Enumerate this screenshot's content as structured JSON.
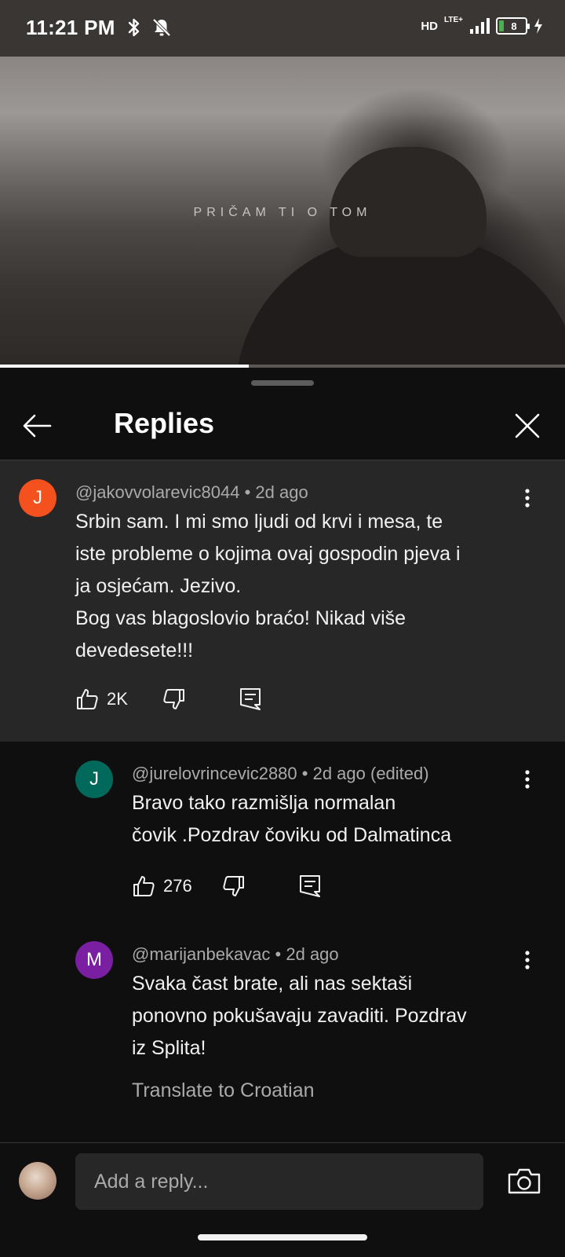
{
  "status_bar": {
    "time": "11:21 PM",
    "network": "HD",
    "network_type": "LTE+",
    "battery_level": "8",
    "icons": [
      "bluetooth-icon",
      "mute-icon",
      "signal-icon",
      "battery-icon",
      "charging-icon"
    ]
  },
  "video": {
    "caption": "PRIČAM TI O TOM",
    "progress": 0.44
  },
  "panel": {
    "title": "Replies",
    "back_icon": "back-arrow-icon",
    "close_icon": "close-icon"
  },
  "comments": [
    {
      "avatar_letter": "J",
      "avatar_color": "#f4511e",
      "author": "@jakovvolarevic8044",
      "time": "2d ago",
      "lines": [
        "Srbin sam. I mi smo ljudi od krvi i mesa, te",
        "iste probleme o kojima ovaj gospodin pjeva i",
        "ja osjećam. Jezivo.",
        "Bog vas blagoslovio braćo! Nikad više",
        "devedesete!!!"
      ],
      "likes": "2K"
    },
    {
      "avatar_letter": "J",
      "avatar_color": "#00695c",
      "author": "@jurelovrincevic2880",
      "time": "2d ago (edited)",
      "lines": [
        "Bravo tako razmišlja normalan",
        "čovik .Pozdrav čoviku od Dalmatinca"
      ],
      "likes": "276"
    },
    {
      "avatar_letter": "M",
      "avatar_color": "#7b1fa2",
      "author": "@marijanbekavac",
      "time": "2d ago",
      "lines": [
        "Svaka čast brate, ali nas sektaši",
        "ponovno pokušavaju zavaditi. Pozdrav",
        "iz Splita!"
      ],
      "translate": "Translate to Croatian"
    }
  ],
  "reply_bar": {
    "placeholder": "Add a reply...",
    "camera_icon": "camera-icon"
  }
}
